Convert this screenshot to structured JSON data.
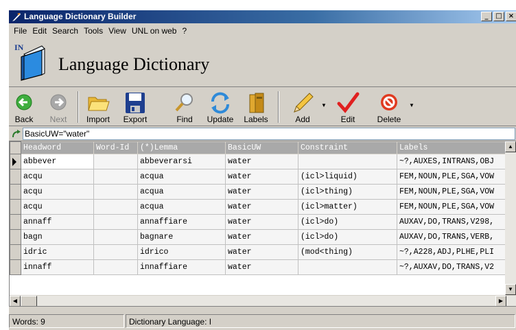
{
  "window": {
    "title": "Language Dictionary Builder",
    "controls": [
      "_",
      "□",
      "×"
    ]
  },
  "menu": [
    "File",
    "Edit",
    "Search",
    "Tools",
    "View",
    "UNL on web",
    "?"
  ],
  "banner": {
    "heading": "Language Dictionary",
    "logo_text": "IN"
  },
  "toolbar": {
    "back": "Back",
    "next": "Next",
    "import": "Import",
    "export": "Export",
    "find": "Find",
    "update": "Update",
    "labels": "Labels",
    "add": "Add",
    "edit": "Edit",
    "delete": "Delete"
  },
  "filter": {
    "value": "BasicUW=\"water\""
  },
  "grid": {
    "columns": [
      "Headword",
      "Word-Id",
      "(*)Lemma",
      "BasicUW",
      "Constraint",
      "Labels"
    ],
    "rows": [
      [
        "abbever",
        "",
        "abbeverarsi",
        "water",
        "",
        "~?,AUXES,INTRANS,OBJ"
      ],
      [
        "acqu",
        "",
        "acqua",
        "water",
        "(icl>liquid)",
        "FEM,NOUN,PLE,SGA,VOW"
      ],
      [
        "acqu",
        "",
        "acqua",
        "water",
        "(icl>thing)",
        "FEM,NOUN,PLE,SGA,VOW"
      ],
      [
        "acqu",
        "",
        "acqua",
        "water",
        "(icl>matter)",
        "FEM,NOUN,PLE,SGA,VOW"
      ],
      [
        "annaff",
        "",
        "annaffiare",
        "water",
        "(icl>do)",
        "AUXAV,DO,TRANS,V298,"
      ],
      [
        "bagn",
        "",
        "bagnare",
        "water",
        "(icl>do)",
        "AUXAV,DO,TRANS,VERB,"
      ],
      [
        "idric",
        "",
        "idrico",
        "water",
        "(mod<thing)",
        "~?,A228,ADJ,PLHE,PLI"
      ],
      [
        "innaff",
        "",
        "innaffiare",
        "water",
        "",
        "~?,AUXAV,DO,TRANS,V2"
      ]
    ]
  },
  "status": {
    "words": "Words: 9",
    "language": "Dictionary Language: I"
  },
  "colors": {
    "titlebar_start": "#0a246a",
    "titlebar_end": "#a6caf0",
    "grid_header": "#a9a9a9",
    "window": "#d4d0c8"
  }
}
